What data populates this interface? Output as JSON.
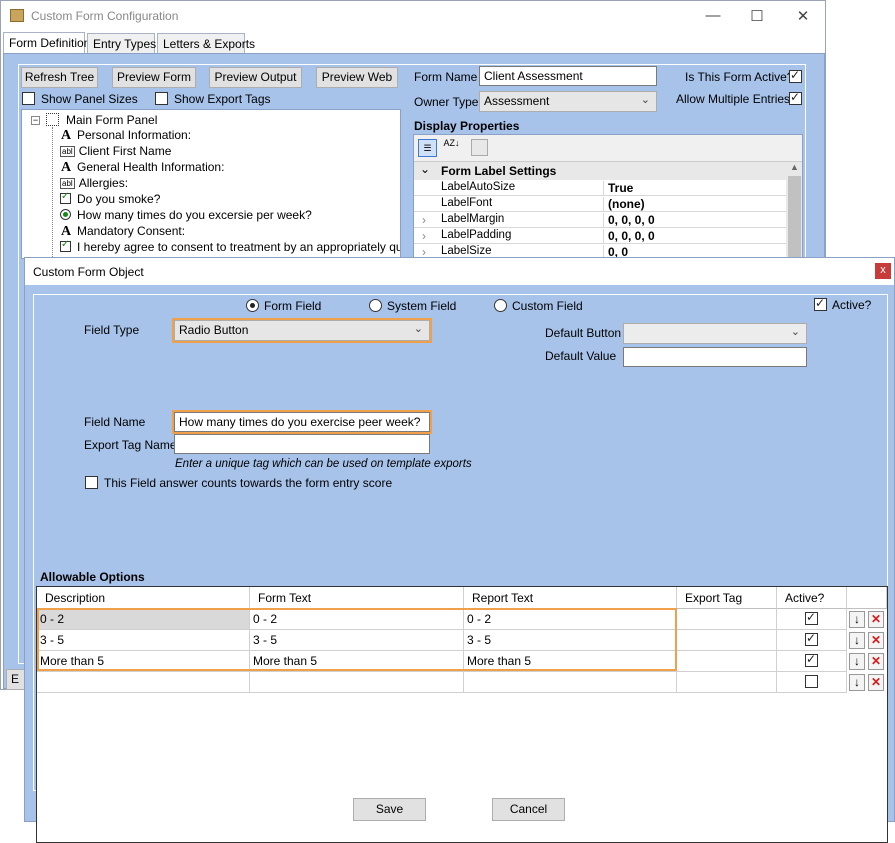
{
  "back_window": {
    "title": "Custom Form Configuration",
    "controls": [
      "—",
      "☐",
      "✕"
    ],
    "tabs": [
      "Form Definition",
      "Entry Types",
      "Letters & Exports"
    ],
    "toolbar": [
      "Refresh Tree",
      "Preview Form",
      "Preview Output",
      "Preview Web"
    ],
    "show_panel_sizes": "Show Panel Sizes",
    "show_export_tags": "Show Export Tags",
    "tree": {
      "root": "Main Form Panel",
      "items": [
        {
          "icon": "A",
          "label": "Personal Information:"
        },
        {
          "icon": "abl",
          "label": "Client First Name"
        },
        {
          "icon": "A",
          "label": "General Health Information:"
        },
        {
          "icon": "abl",
          "label": "Allergies:"
        },
        {
          "icon": "check",
          "label": "Do you smoke?"
        },
        {
          "icon": "radio",
          "label": "How many times do you excersie per week?"
        },
        {
          "icon": "A",
          "label": "Mandatory Consent:"
        },
        {
          "icon": "check",
          "label": "I hereby agree to consent to treatment by an appropriately qualified"
        }
      ]
    },
    "form_name_label": "Form Name",
    "form_name_value": "Client Assessment",
    "owner_type_label": "Owner Type",
    "owner_type_value": "Assessment",
    "form_active_label": "Is This Form Active?",
    "allow_multiple_label": "Allow Multiple Entries?",
    "display_properties_label": "Display Properties",
    "prop_category": "Form Label Settings",
    "props": [
      {
        "name": "LabelAutoSize",
        "value": "True"
      },
      {
        "name": "LabelFont",
        "value": "(none)"
      },
      {
        "name": "LabelMargin",
        "value": "0, 0, 0, 0"
      },
      {
        "name": "LabelPadding",
        "value": "0, 0, 0, 0"
      },
      {
        "name": "LabelSize",
        "value": "0, 0"
      }
    ],
    "bottom_button_fragment": "E"
  },
  "dialog": {
    "title": "Custom Form Object",
    "close": "x",
    "radio_form_field": "Form Field",
    "radio_system_field": "System Field",
    "radio_custom_field": "Custom Field",
    "active_label": "Active?",
    "field_type_label": "Field Type",
    "field_type_value": "Radio Button",
    "default_button_label": "Default Button",
    "default_button_value": "",
    "default_value_label": "Default Value",
    "default_value": "",
    "field_name_label": "Field Name",
    "field_name_value": "How many times do you exercise peer week?",
    "export_tag_label": "Export Tag Name",
    "export_tag_value": "",
    "export_tag_hint": "Enter a unique tag which can be used on template exports",
    "score_label": "This Field answer counts towards the form entry score",
    "allowable_options_label": "Allowable Options",
    "columns": [
      "Description",
      "Form Text",
      "Report Text",
      "Export Tag",
      "Active?"
    ],
    "rows": [
      {
        "description": "0 - 2",
        "form_text": "0 - 2",
        "report_text": "0 - 2",
        "export_tag": "",
        "active": true
      },
      {
        "description": "3 - 5",
        "form_text": "3 - 5",
        "report_text": "3 - 5",
        "export_tag": "",
        "active": true
      },
      {
        "description": "More than 5",
        "form_text": "More than 5",
        "report_text": "More than 5",
        "export_tag": "",
        "active": true
      },
      {
        "description": "",
        "form_text": "",
        "report_text": "",
        "export_tag": "",
        "active": false
      }
    ],
    "move_down_glyph": "↓",
    "delete_glyph": "✕",
    "save_label": "Save",
    "cancel_label": "Cancel"
  },
  "colors": {
    "panel_blue": "#a7c3ea",
    "highlight_orange": "#f0a04b",
    "delete_red": "#d81b1b"
  }
}
